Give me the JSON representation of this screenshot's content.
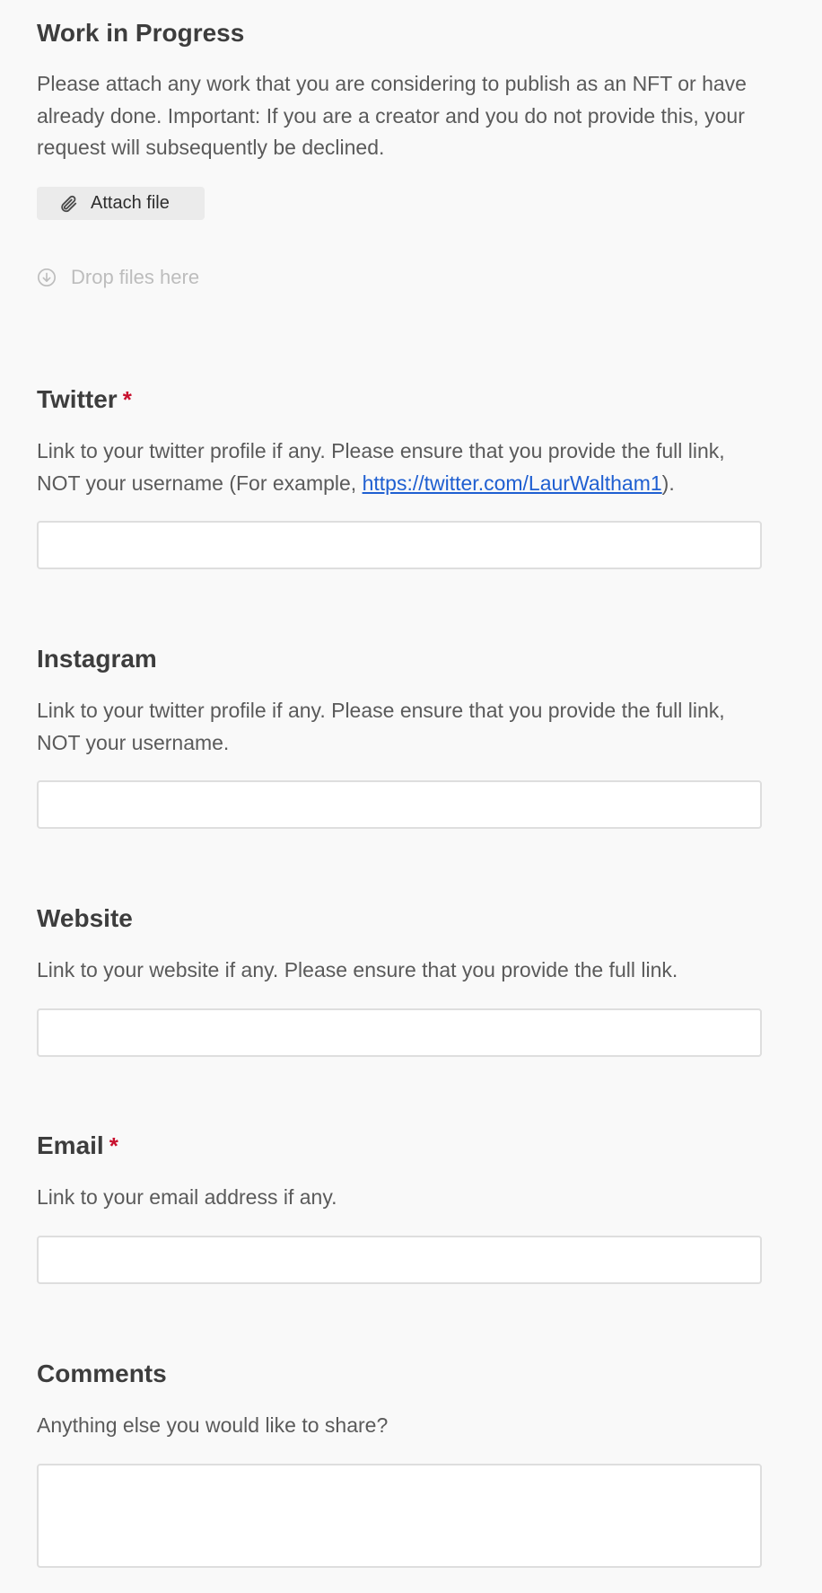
{
  "wip": {
    "title": "Work in Progress",
    "description": "Please attach any work that you are considering to publish as an NFT or have already done. Important: If you are a creator and you do not provide this, your request will subsequently be declined.",
    "attach_label": "Attach file",
    "attach_icon": "paperclip-icon",
    "drop_label": "Drop files here",
    "drop_icon": "download-circle-icon"
  },
  "twitter": {
    "title": "Twitter",
    "required_mark": "*",
    "description_before": "Link to your twitter profile if any. Please ensure that you provide the full link, NOT your username (For example, ",
    "example_link": "https://twitter.com/LaurWaltham1",
    "description_after": ").",
    "value": ""
  },
  "instagram": {
    "title": "Instagram",
    "description": "Link to your twitter profile if any. Please ensure that you provide the full link, NOT your username.",
    "value": ""
  },
  "website": {
    "title": "Website",
    "description": "Link to your website if any. Please ensure that you provide the full link.",
    "value": ""
  },
  "email": {
    "title": "Email",
    "required_mark": "*",
    "description": "Link to your email address if any.",
    "value": ""
  },
  "comments": {
    "title": "Comments",
    "description": "Anything else you would like to share?",
    "value": ""
  },
  "colors": {
    "background": "#f9f9f9",
    "required": "#c8102e",
    "link": "#1f5fd1",
    "input_border": "#dedede"
  }
}
